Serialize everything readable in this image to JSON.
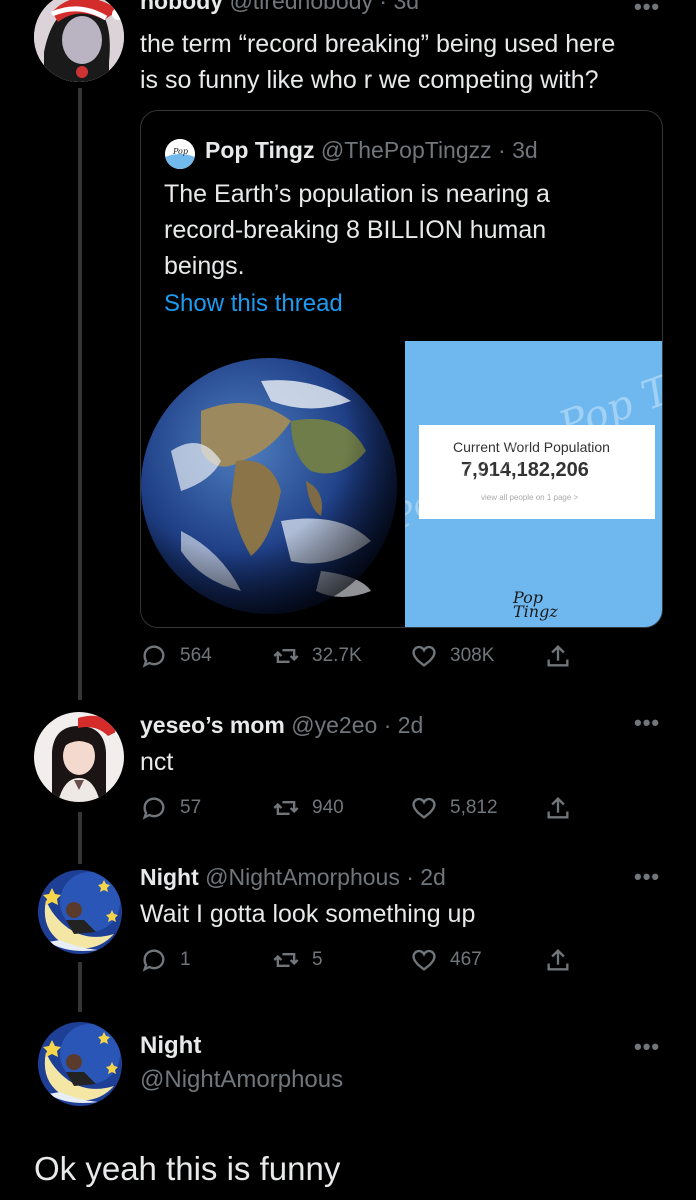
{
  "tweets": [
    {
      "name": "nobody",
      "handle": "@tirednobody",
      "time": "· 3d",
      "text_lines": [
        "the term “record breaking” being used here",
        "is so funny like who r we competing with?"
      ],
      "quote": {
        "name": "Pop Tingz",
        "handle": "@ThePopTingzz",
        "time": "· 3d",
        "text_lines": [
          "The Earth’s population is nearing a",
          "record-breaking 8 BILLION human",
          "beings."
        ],
        "show_thread": "Show this thread",
        "card": {
          "title": "Current World Population",
          "value": "7,914,182,206",
          "sub": "view all people on 1 page >",
          "watermark": "Pop Tingz"
        }
      },
      "stats": {
        "replies": "564",
        "retweets": "32.7K",
        "likes": "308K"
      }
    },
    {
      "name": "yeseo’s mom",
      "handle": "@ye2eo",
      "time": "· 2d",
      "text_lines": [
        "nct"
      ],
      "stats": {
        "replies": "57",
        "retweets": "940",
        "likes": "5,812"
      }
    },
    {
      "name": "Night",
      "handle": "@NightAmorphous",
      "time": "· 2d",
      "text_lines": [
        "Wait I gotta look something up"
      ],
      "stats": {
        "replies": "1",
        "retweets": "5",
        "likes": "467"
      }
    }
  ],
  "main_tweet": {
    "name": "Night",
    "handle": "@NightAmorphous",
    "text": "Ok yeah this is funny"
  },
  "more_label": "•••",
  "colors": {
    "background": "#000000",
    "text": "#e7e9ea",
    "muted": "#71767b",
    "link": "#1d9bf0",
    "line": "#333639",
    "card_bg": "#6fb8ef"
  },
  "icons": [
    "reply-icon",
    "retweet-icon",
    "like-icon",
    "share-icon",
    "more-icon"
  ]
}
